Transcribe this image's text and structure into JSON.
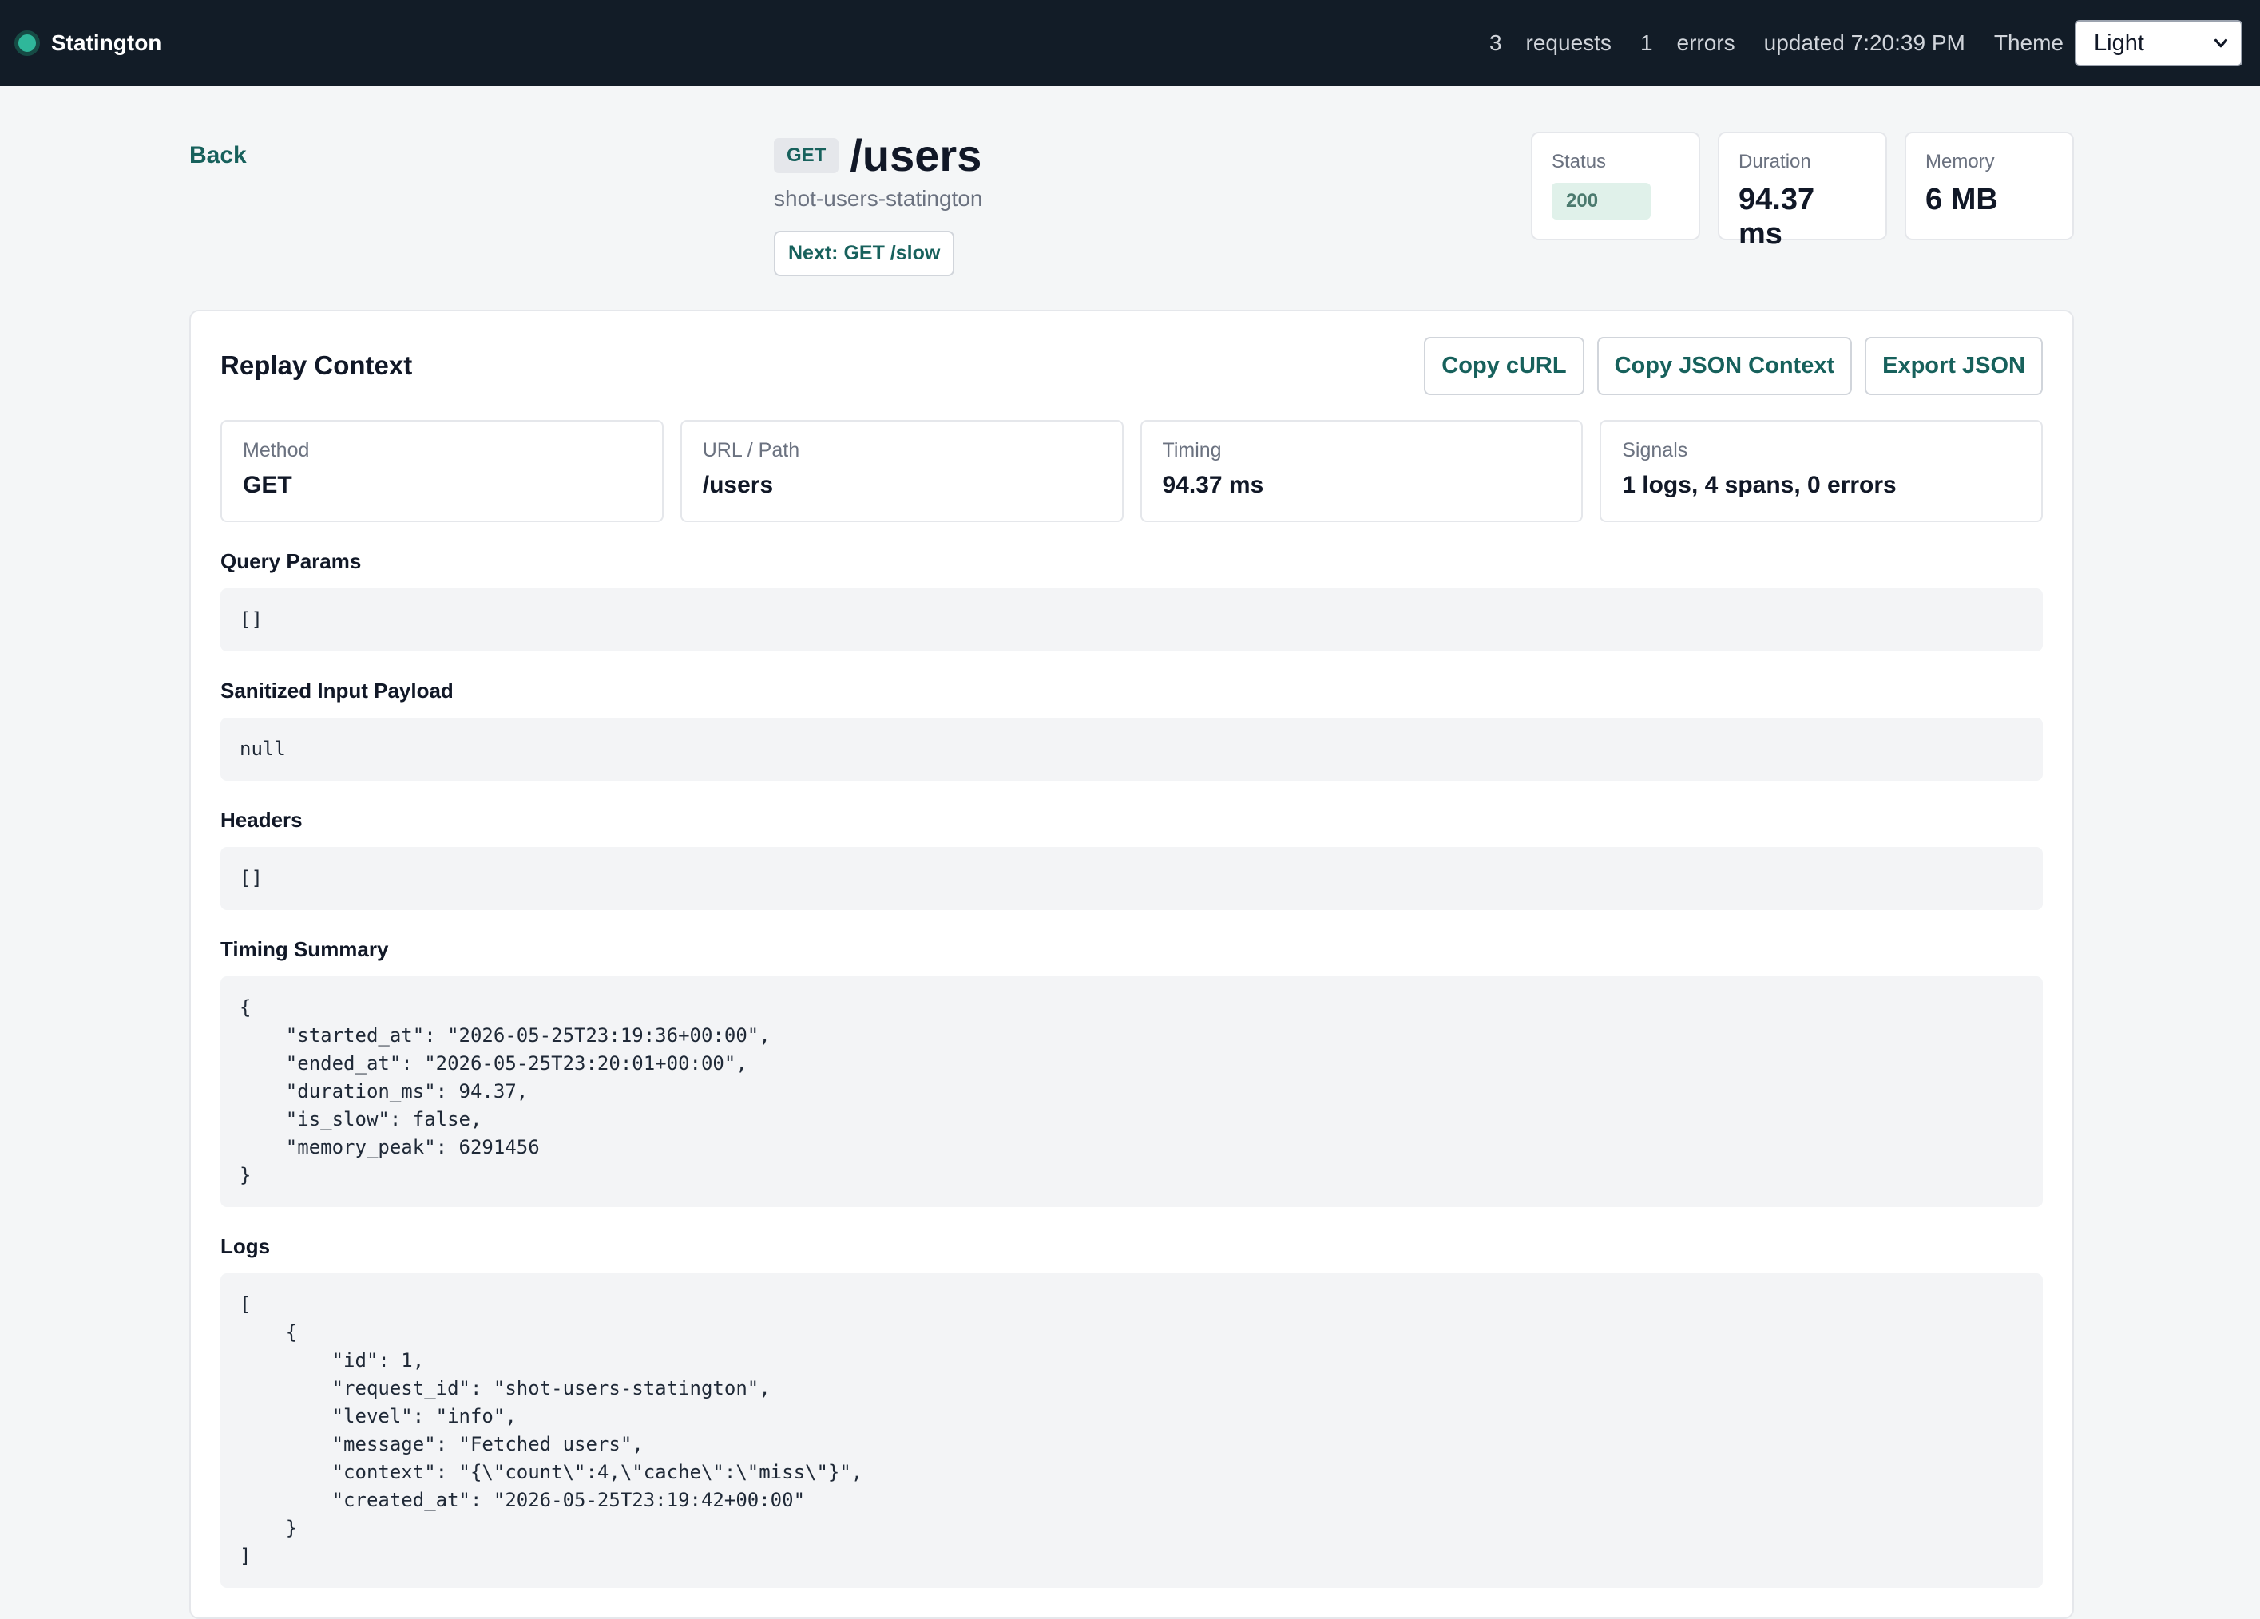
{
  "topbar": {
    "brand": "Statington",
    "request_count": "3",
    "requests_label": "requests",
    "error_count": "1",
    "errors_label": "errors",
    "updated": "updated 7:20:39 PM",
    "theme_label": "Theme",
    "theme_value": "Light"
  },
  "header": {
    "back": "Back",
    "method": "GET",
    "path": "/users",
    "request_id": "shot-users-statington",
    "next": "Next: GET /slow",
    "stats": {
      "status_label": "Status",
      "status_value": "200",
      "duration_label": "Duration",
      "duration_value": "94.37 ms",
      "memory_label": "Memory",
      "memory_value": "6 MB"
    }
  },
  "panel": {
    "title": "Replay Context",
    "actions": [
      "Copy cURL",
      "Copy JSON Context",
      "Export JSON"
    ],
    "summary": [
      {
        "label": "Method",
        "value": "GET"
      },
      {
        "label": "URL / Path",
        "value": "/users"
      },
      {
        "label": "Timing",
        "value": "94.37 ms"
      },
      {
        "label": "Signals",
        "value": "1 logs, 4 spans, 0 errors"
      }
    ],
    "sections": [
      {
        "title": "Query Params",
        "code": "[]"
      },
      {
        "title": "Sanitized Input Payload",
        "code": "null"
      },
      {
        "title": "Headers",
        "code": "[]"
      },
      {
        "title": "Timing Summary",
        "code": "{\n    \"started_at\": \"2026-05-25T23:19:36+00:00\",\n    \"ended_at\": \"2026-05-25T23:20:01+00:00\",\n    \"duration_ms\": 94.37,\n    \"is_slow\": false,\n    \"memory_peak\": 6291456\n}"
      },
      {
        "title": "Logs",
        "code": "[\n    {\n        \"id\": 1,\n        \"request_id\": \"shot-users-statington\",\n        \"level\": \"info\",\n        \"message\": \"Fetched users\",\n        \"context\": \"{\\\"count\\\":4,\\\"cache\\\":\\\"miss\\\"}\",\n        \"created_at\": \"2026-05-25T23:19:42+00:00\"\n    }\n]"
      }
    ]
  }
}
